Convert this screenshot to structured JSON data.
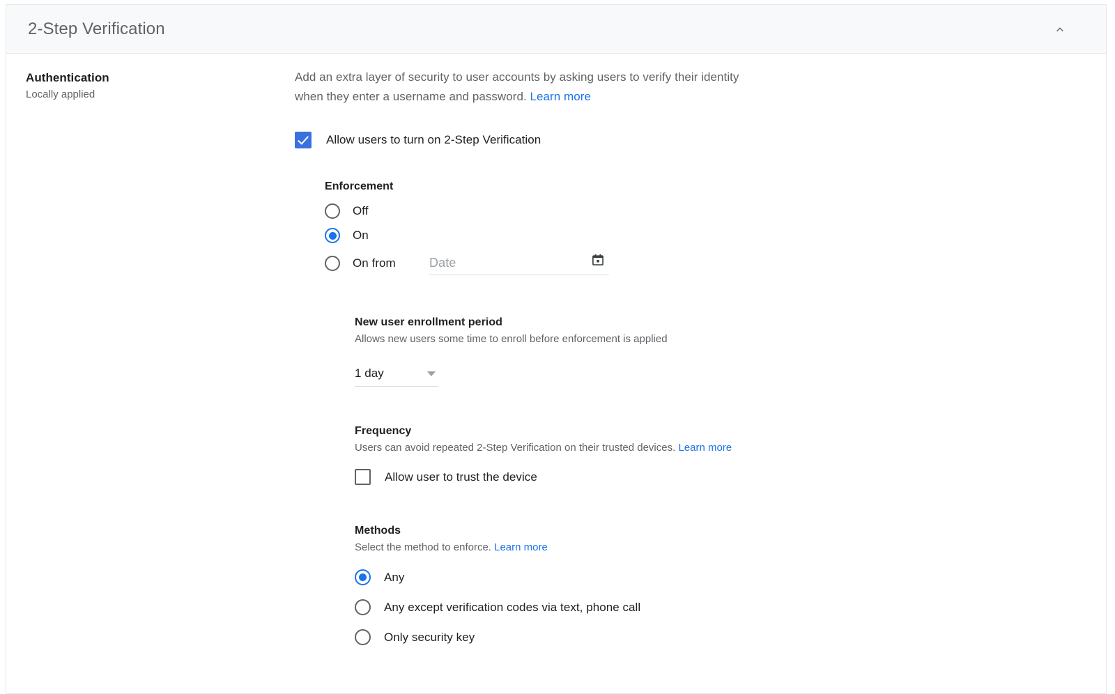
{
  "header": {
    "title": "2-Step Verification",
    "collapse_icon": "chevron-up-icon"
  },
  "left_column": {
    "section_name": "Authentication",
    "section_sub": "Locally applied"
  },
  "description": {
    "text": "Add an extra layer of security to user accounts by asking users to verify their identity when they enter a username and password.",
    "link_label": "Learn more"
  },
  "allow_toggle": {
    "label": "Allow users to turn on 2-Step Verification",
    "checked": true
  },
  "enforcement": {
    "title": "Enforcement",
    "options": [
      {
        "label": "Off",
        "selected": false
      },
      {
        "label": "On",
        "selected": true
      },
      {
        "label": "On from",
        "selected": false
      }
    ],
    "date_field": {
      "value": "",
      "placeholder": "Date",
      "icon": "calendar-icon"
    }
  },
  "enrollment": {
    "title": "New user enrollment period",
    "subtitle": "Allows new users some time to enroll before enforcement is applied",
    "select_value": "1 day",
    "select_icon": "caret-down-icon"
  },
  "frequency": {
    "title": "Frequency",
    "subtitle": "Users can avoid repeated 2-Step Verification on their trusted devices.",
    "link_label": "Learn more",
    "checkbox_label": "Allow user to trust the device",
    "checked": false
  },
  "methods": {
    "title": "Methods",
    "subtitle": "Select the method to enforce.",
    "link_label": "Learn more",
    "options": [
      {
        "label": "Any",
        "selected": true
      },
      {
        "label": "Any except verification codes via text, phone call",
        "selected": false
      },
      {
        "label": "Only security key",
        "selected": false
      }
    ]
  },
  "colors": {
    "accent_blue": "#1a73e8",
    "checkbox_blue": "#3a71e0",
    "link_blue": "#1a73e8",
    "header_bg": "#f8f9fa",
    "text_primary": "#202124",
    "text_secondary": "#5f6368"
  }
}
